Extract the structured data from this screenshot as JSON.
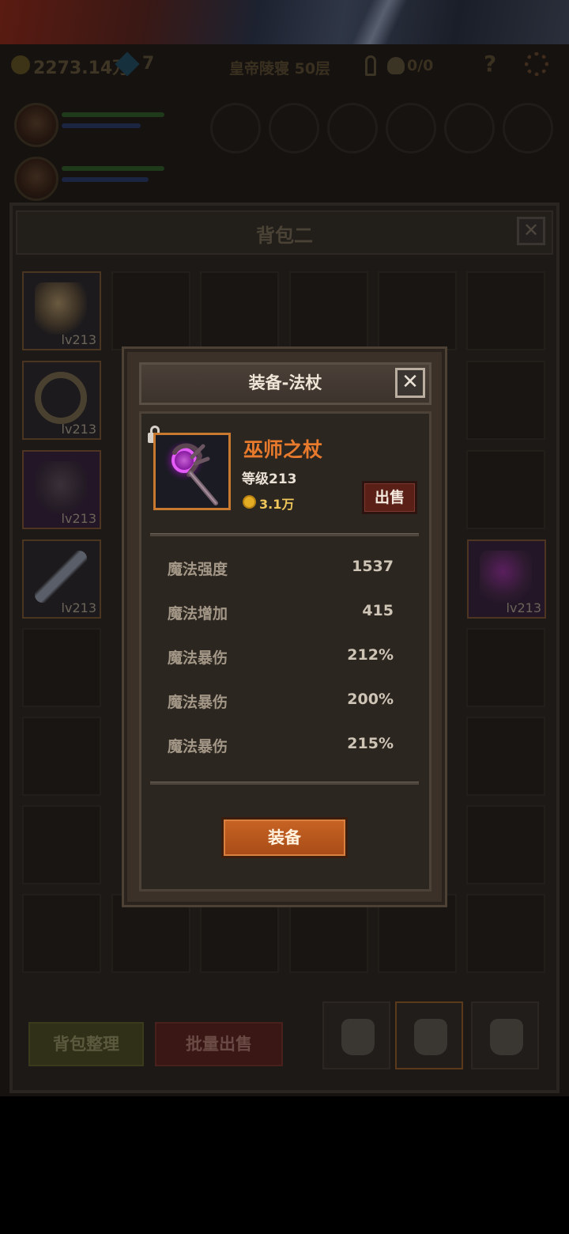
{
  "status": {
    "gold": "2273.14万",
    "gems": "7",
    "stage": "皇帝陵寝 50层",
    "keys": "0/0",
    "help": "?"
  },
  "backpack": {
    "title": "背包二",
    "close": "✕",
    "item_level": "lv213",
    "sort_label": "背包整理",
    "bulk_sell_label": "批量出售"
  },
  "modal": {
    "title": "装备-法杖",
    "close": "✕",
    "item_name": "巫师之杖",
    "item_level": "等级213",
    "price": "3.1万",
    "sell_label": "出售",
    "equip_label": "装备",
    "stats": [
      {
        "label": "魔法强度",
        "value": "1537"
      },
      {
        "label": "魔法增加",
        "value": "415"
      },
      {
        "label": "魔法暴伤",
        "value": "212%"
      },
      {
        "label": "魔法暴伤",
        "value": "200%"
      },
      {
        "label": "魔法暴伤",
        "value": "215%"
      }
    ]
  },
  "colors": {
    "accent": "#e77a2c",
    "equip_button": "#b8561c",
    "sell_button": "#5a2018",
    "price": "#efc65a"
  }
}
